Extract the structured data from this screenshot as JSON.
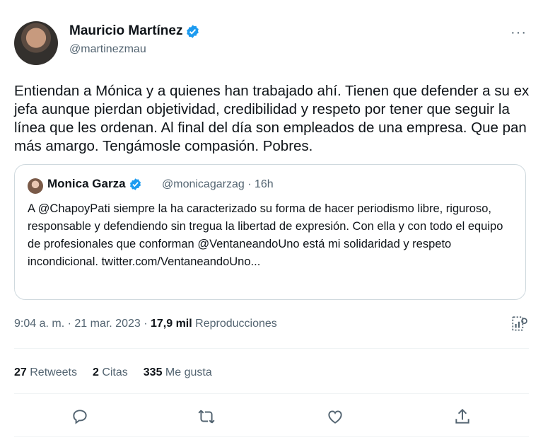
{
  "author": {
    "name": "Mauricio Martínez",
    "handle": "@martinezmau"
  },
  "more_label": "···",
  "tweet_text": "Entiendan a Mónica y a quienes han trabajado ahí. Tienen que defender a su ex jefa aunque pierdan objetividad, credibilidad y respeto por tener que seguir la línea que les ordenan. Al final del día son empleados de una empresa. Que pan más amargo. Tengámosle compasión. Pobres.",
  "quote": {
    "name": "Monica Garza",
    "handle_time": "@monicagarzag · 16h",
    "text": "A @ChapoyPati siempre la ha caracterizado su forma de hacer periodismo libre, riguroso, responsable y defendiendo sin tregua la libertad de expresión. Con ella y con todo el equipo de profesionales que conforman @VentaneandoUno está mi solidaridad y respeto incondicional. twitter.com/VentaneandoUno..."
  },
  "meta": {
    "timestamp": "9:04 a. m. · 21 mar. 2023 · ",
    "views_count": "17,9 mil",
    "views_label": " Reproducciones"
  },
  "stats": {
    "retweets_count": "27",
    "retweets_label": "Retweets",
    "quotes_count": "2",
    "quotes_label": "Citas",
    "likes_count": "335",
    "likes_label": "Me gusta"
  },
  "colors": {
    "verified": "#1d9bf0",
    "secondary": "#536471",
    "primary": "#0f1419"
  },
  "icons": [
    "verified-badge-icon",
    "more-icon",
    "analytics-icon",
    "reply-icon",
    "retweet-icon",
    "like-icon",
    "share-icon"
  ]
}
